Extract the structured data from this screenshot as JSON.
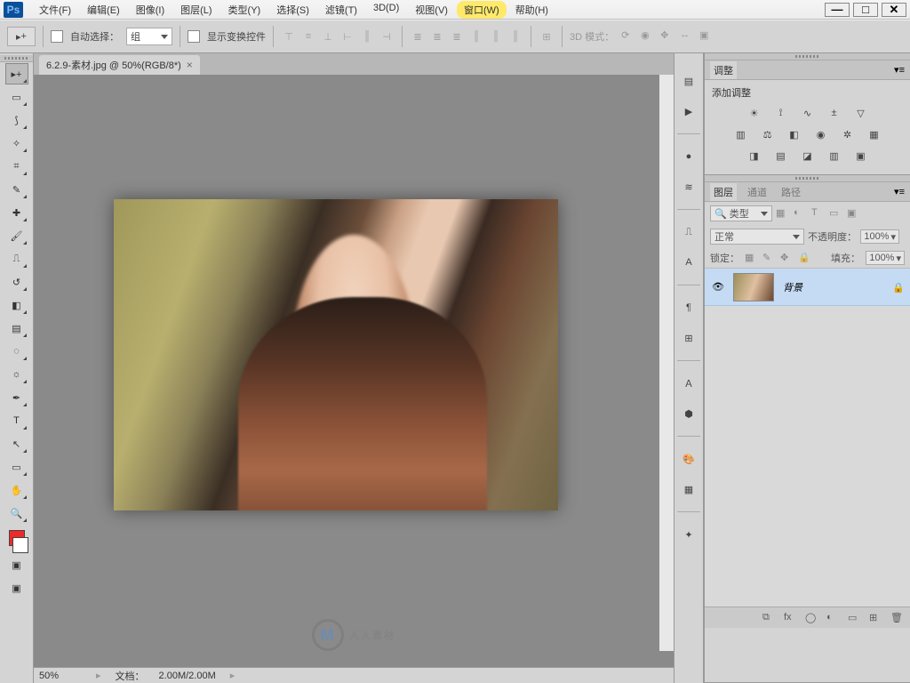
{
  "app": {
    "logo_text": "Ps"
  },
  "menu": {
    "items": [
      "文件(F)",
      "编辑(E)",
      "图像(I)",
      "图层(L)",
      "类型(Y)",
      "选择(S)",
      "滤镜(T)",
      "3D(D)",
      "视图(V)",
      "窗口(W)",
      "帮助(H)"
    ],
    "highlight_index": 9
  },
  "window_controls": {
    "min": "—",
    "max": "□",
    "close": "✕"
  },
  "options": {
    "auto_select_label": "自动选择：",
    "auto_select_value": "组",
    "show_transform_label": "显示变换控件",
    "mode3d_label": "3D 模式："
  },
  "tools": [
    "move",
    "marquee",
    "lasso",
    "magic-wand",
    "crop",
    "eyedropper",
    "healing",
    "brush",
    "stamp",
    "history-brush",
    "eraser",
    "gradient",
    "blur",
    "dodge",
    "pen",
    "type",
    "path-select",
    "rectangle",
    "hand",
    "zoom"
  ],
  "document": {
    "tab_title": "6.2.9-素材.jpg @ 50%(RGB/8*)",
    "zoom": "50%",
    "status_label": "文档：",
    "status_value": "2.00M/2.00M"
  },
  "watermark": {
    "logo": "M",
    "text": "人人素材"
  },
  "dock_icons": [
    "history",
    "actions",
    "brush-tip",
    "brush-preset",
    "clone",
    "char",
    "para",
    "glyph",
    "glyph-a",
    "3d",
    "swatches",
    "swatches2",
    "fx"
  ],
  "adjustments": {
    "tab": "调整",
    "title": "添加调整",
    "icons": [
      [
        "brightness",
        "levels",
        "curves",
        "exposure",
        "triangle"
      ],
      [
        "vibrance",
        "balance",
        "bw",
        "photo-filter",
        "mixer",
        "lut"
      ],
      [
        "invert",
        "poster",
        "threshold",
        "gradient-map",
        "selective"
      ]
    ]
  },
  "layers": {
    "tabs": [
      "图层",
      "通道",
      "路径"
    ],
    "active_tab": 0,
    "kind_label": "类型",
    "blend_mode": "正常",
    "opacity_label": "不透明度：",
    "opacity_value": "100%",
    "lock_label": "锁定：",
    "fill_label": "填充：",
    "fill_value": "100%",
    "items": [
      {
        "name": "背景",
        "locked": true
      }
    ],
    "footer_icons": [
      "link",
      "fx",
      "mask",
      "adjustment",
      "group",
      "new",
      "trash"
    ]
  }
}
